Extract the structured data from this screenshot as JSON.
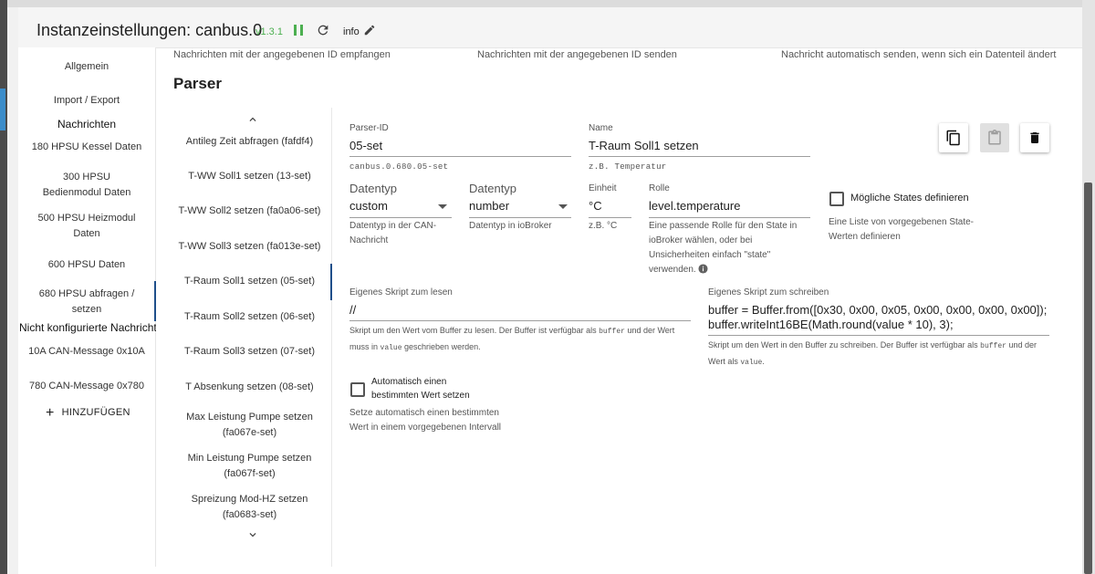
{
  "header": {
    "title": "Instanzeinstellungen: canbus.0",
    "version": "v1.3.1",
    "info_label": "info"
  },
  "nav": {
    "items_top": [
      {
        "label": "Allgemein"
      },
      {
        "label": "Import / Export"
      }
    ],
    "section_messages": "Nachrichten",
    "messages": [
      "180 HPSU Kessel Daten",
      "300 HPSU Bedienmodul Daten",
      "500 HPSU Heizmodul Daten",
      "600 HPSU Daten",
      "680 HPSU abfragen / setzen"
    ],
    "section_unconfigured": "Nicht konfigurierte Nachrichten",
    "unconfigured": [
      "10A CAN-Message 0x10A",
      "780 CAN-Message 0x780"
    ],
    "add_label": "HINZUFÜGEN"
  },
  "hints": {
    "receive": "Nachrichten mit der angegebenen ID empfangen",
    "send": "Nachrichten mit der angegebenen ID senden",
    "auto_send": "Nachricht automatisch senden, wenn sich ein Datenteil ändert"
  },
  "parser": {
    "heading": "Parser",
    "list": [
      "Antileg Zeit abfragen (fafdf4)",
      "T-WW Soll1 setzen (13-set)",
      "T-WW Soll2 setzen (fa0a06-set)",
      "T-WW Soll3 setzen (fa013e-set)",
      "T-Raum Soll1 setzen (05-set)",
      "T-Raum Soll2 setzen (06-set)",
      "T-Raum Soll3 setzen (07-set)",
      "T Absenkung setzen (08-set)",
      "Max Leistung Pumpe setzen (fa067e-set)",
      "Min Leistung Pumpe setzen (fa067f-set)",
      "Spreizung Mod-HZ setzen (fa0683-set)"
    ],
    "selected_index": 4
  },
  "form": {
    "parser_id": {
      "label": "Parser-ID",
      "value": "05-set",
      "helper": "canbus.0.680.05-set"
    },
    "name": {
      "label": "Name",
      "value": "T-Raum Soll1 setzen",
      "helper": "z.B. Temperatur"
    },
    "datatype": {
      "label": "Datentyp",
      "value": "custom",
      "helper": "Datentyp in der CAN-Nachricht"
    },
    "datatype_iob": {
      "label": "Datentyp",
      "value": "number",
      "helper": "Datentyp in ioBroker"
    },
    "unit": {
      "label": "Einheit",
      "value": "°C",
      "helper": "z.B. °C"
    },
    "role": {
      "label": "Rolle",
      "value": "level.temperature",
      "helper": "Eine passende Rolle für den State in ioBroker wählen, oder bei Unsicherheiten einfach \"state\" verwenden."
    },
    "states": {
      "label": "Mögliche States definieren",
      "helper": "Eine Liste von vorgegebenen State-Werten definieren",
      "checked": false
    },
    "read_script": {
      "label": "Eigenes Skript zum lesen",
      "value": "//",
      "helper_1": "Skript um den Wert vom Buffer zu lesen. Der Buffer ist verfügbar als ",
      "code_1": "buffer",
      "helper_2": " und der Wert muss in ",
      "code_2": "value",
      "helper_3": " geschrieben werden."
    },
    "write_script": {
      "label": "Eigenes Skript zum schreiben",
      "line1": "buffer = Buffer.from([0x30, 0x00, 0x05, 0x00, 0x00, 0x00, 0x00]);",
      "line2": "buffer.writeInt16BE(Math.round(value * 10), 3);",
      "helper_1": "Skript um den Wert in den Buffer zu schreiben. Der Buffer ist verfügbar als ",
      "code_1": "buffer",
      "helper_2": " und der Wert als ",
      "code_2": "value",
      "helper_3": "."
    },
    "auto_value": {
      "label": "Automatisch einen bestimmten Wert setzen",
      "helper": "Setze automatisch einen bestimmten Wert in einem vorgegebenen Intervall",
      "checked": false
    }
  },
  "icons": {
    "pause": "pause-icon",
    "reload": "reload-icon",
    "edit": "pencil-icon",
    "copy": "copy-icon",
    "paste": "paste-icon",
    "delete": "trash-icon",
    "info": "info-icon",
    "dropdown": "dropdown-arrow-icon",
    "up": "chevron-up-icon",
    "down": "chevron-down-icon"
  },
  "colors": {
    "version": "#4caf50",
    "selection": "#1e4f8a",
    "accent_left": "#3c8dca"
  }
}
